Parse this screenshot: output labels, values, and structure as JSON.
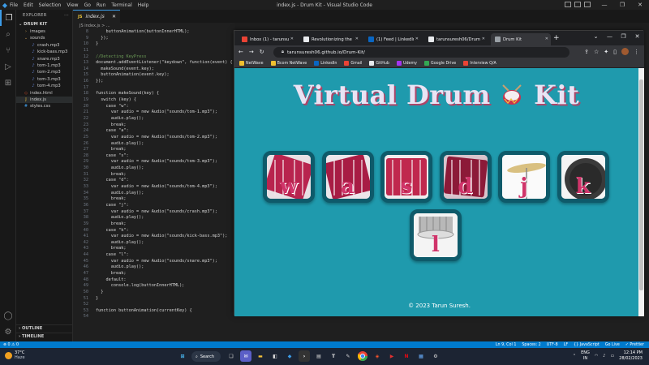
{
  "vscode": {
    "title": "index.js - Drum Kit - Visual Studio Code",
    "menu": [
      "File",
      "Edit",
      "Selection",
      "View",
      "Go",
      "Run",
      "Terminal",
      "Help"
    ],
    "explorer": {
      "header": "EXPLORER",
      "project": "DRUM KIT",
      "tree": [
        {
          "label": "images",
          "icon": "folder-icon",
          "depth": 1
        },
        {
          "label": "sounds",
          "icon": "folder-open-icon",
          "depth": 1
        },
        {
          "label": "crash.mp3",
          "icon": "audio-file-icon",
          "depth": 2
        },
        {
          "label": "kick-bass.mp3",
          "icon": "audio-file-icon",
          "depth": 2
        },
        {
          "label": "snare.mp3",
          "icon": "audio-file-icon",
          "depth": 2
        },
        {
          "label": "tom-1.mp3",
          "icon": "audio-file-icon",
          "depth": 2
        },
        {
          "label": "tom-2.mp3",
          "icon": "audio-file-icon",
          "depth": 2
        },
        {
          "label": "tom-3.mp3",
          "icon": "audio-file-icon",
          "depth": 2
        },
        {
          "label": "tom-4.mp3",
          "icon": "audio-file-icon",
          "depth": 2
        },
        {
          "label": "index.html",
          "icon": "html-file-icon",
          "depth": 1
        },
        {
          "label": "index.js",
          "icon": "js-file-icon",
          "depth": 1
        },
        {
          "label": "styles.css",
          "icon": "css-file-icon",
          "depth": 1
        }
      ],
      "outline": "OUTLINE",
      "timeline": "TIMELINE"
    },
    "tab": {
      "badge": "JS",
      "label": "index.js"
    },
    "breadcrumb": "JS index.js > ...",
    "code": [
      {
        "n": "8",
        "t": "    buttonAnimation(buttonInnerHTML);"
      },
      {
        "n": "9",
        "t": "  });"
      },
      {
        "n": "10",
        "t": "}"
      },
      {
        "n": "11",
        "t": ""
      },
      {
        "n": "12",
        "t": "//Detecting KeyPress",
        "comment": true
      },
      {
        "n": "13",
        "t": "document.addEventListener(\"keydown\", function(event) {"
      },
      {
        "n": "14",
        "t": "  makeSound(event.key);"
      },
      {
        "n": "15",
        "t": "  buttonAnimation(event.key);"
      },
      {
        "n": "16",
        "t": "});"
      },
      {
        "n": "17",
        "t": ""
      },
      {
        "n": "18",
        "t": "function makeSound(key) {"
      },
      {
        "n": "19",
        "t": "  switch (key) {"
      },
      {
        "n": "20",
        "t": "    case \"w\":"
      },
      {
        "n": "21",
        "t": "      var audio = new Audio(\"sounds/tom-1.mp3\");"
      },
      {
        "n": "22",
        "t": "      audio.play();"
      },
      {
        "n": "23",
        "t": "      break;"
      },
      {
        "n": "24",
        "t": "    case \"a\":"
      },
      {
        "n": "25",
        "t": "      var audio = new Audio(\"sounds/tom-2.mp3\");"
      },
      {
        "n": "26",
        "t": "      audio.play();"
      },
      {
        "n": "27",
        "t": "      break;"
      },
      {
        "n": "28",
        "t": "    case \"s\":"
      },
      {
        "n": "29",
        "t": "      var audio = new Audio(\"sounds/tom-3.mp3\");"
      },
      {
        "n": "30",
        "t": "      audio.play();"
      },
      {
        "n": "31",
        "t": "      break;"
      },
      {
        "n": "32",
        "t": "    case \"d\":"
      },
      {
        "n": "33",
        "t": "      var audio = new Audio(\"sounds/tom-4.mp3\");"
      },
      {
        "n": "34",
        "t": "      audio.play();"
      },
      {
        "n": "35",
        "t": "      break;"
      },
      {
        "n": "36",
        "t": "    case \"j\":"
      },
      {
        "n": "37",
        "t": "      var audio = new Audio(\"sounds/crash.mp3\");"
      },
      {
        "n": "38",
        "t": "      audio.play();"
      },
      {
        "n": "39",
        "t": "      break;"
      },
      {
        "n": "40",
        "t": "    case \"k\":"
      },
      {
        "n": "41",
        "t": "      var audio = new Audio(\"sounds/kick-bass.mp3\");"
      },
      {
        "n": "42",
        "t": "      audio.play();"
      },
      {
        "n": "43",
        "t": "      break;"
      },
      {
        "n": "44",
        "t": "    case \"l\":"
      },
      {
        "n": "45",
        "t": "      var audio = new Audio(\"sounds/snare.mp3\");"
      },
      {
        "n": "46",
        "t": "      audio.play();"
      },
      {
        "n": "47",
        "t": "      break;"
      },
      {
        "n": "48",
        "t": "    default:"
      },
      {
        "n": "49",
        "t": "      console.log(buttonInnerHTML);"
      },
      {
        "n": "50",
        "t": "  }"
      },
      {
        "n": "51",
        "t": "}"
      },
      {
        "n": "52",
        "t": ""
      },
      {
        "n": "53",
        "t": "function buttonAnimation(currentKey) {"
      },
      {
        "n": "54",
        "t": ""
      }
    ],
    "status_left": [
      "⊗ 0 ⚠ 0"
    ],
    "status_right": [
      "Ln 9, Col 1",
      "Spaces: 2",
      "UTF-8",
      "LF",
      "{} JavaScript",
      "Go Live",
      "✓ Prettier"
    ]
  },
  "browser": {
    "tabs": [
      {
        "label": "Inbox (1) - tarunsuresh",
        "favicon_color": "#ea4335",
        "active": false
      },
      {
        "label": "Revolutionizing the Ir",
        "favicon_color": "#e8eaed",
        "active": false
      },
      {
        "label": "(1) Feed | LinkedIn",
        "favicon_color": "#0a66c2",
        "active": false
      },
      {
        "label": "tarunsuresh06/Drum-k",
        "favicon_color": "#e8eaed",
        "active": false
      },
      {
        "label": "Drum Kit",
        "favicon_color": "#9aa0a6",
        "active": true
      }
    ],
    "url": "tarunsuresh06.github.io/Drum-Kit/",
    "bookmarks": [
      {
        "label": "NetWave",
        "color": "#f0c030"
      },
      {
        "label": "Bcom NetWave",
        "color": "#f0c030"
      },
      {
        "label": "LinkedIn",
        "color": "#0a66c2"
      },
      {
        "label": "Gmail",
        "color": "#ea4335"
      },
      {
        "label": "GitHub",
        "color": "#e8eaed"
      },
      {
        "label": "Udemy",
        "color": "#a435f0"
      },
      {
        "label": "Google Drive",
        "color": "#34a853"
      },
      {
        "label": "Interview Q/A",
        "color": "#ea4335"
      }
    ]
  },
  "drumkit": {
    "title_left": "Virtual Drum",
    "title_right": "Kit",
    "keys": [
      {
        "letter": "w",
        "sound": "tom-1"
      },
      {
        "letter": "a",
        "sound": "tom-2"
      },
      {
        "letter": "s",
        "sound": "tom-3"
      },
      {
        "letter": "d",
        "sound": "tom-4"
      },
      {
        "letter": "j",
        "sound": "crash"
      },
      {
        "letter": "k",
        "sound": "kick-bass"
      },
      {
        "letter": "l",
        "sound": "snare"
      }
    ],
    "footer": "© 2023 Tarun Suresh."
  },
  "taskbar": {
    "temp": "37°C",
    "weather": "Haze",
    "search": "Search",
    "lang_top": "ENG",
    "lang_bottom": "IN",
    "time": "12:14 PM",
    "date": "28/02/2023"
  },
  "colors": {
    "page_bg": "#1f9aad",
    "key_border": "#0e5a6a",
    "key_letter": "#d0346a",
    "title_shadow": "#ad4568",
    "vscode_status": "#007acc"
  }
}
